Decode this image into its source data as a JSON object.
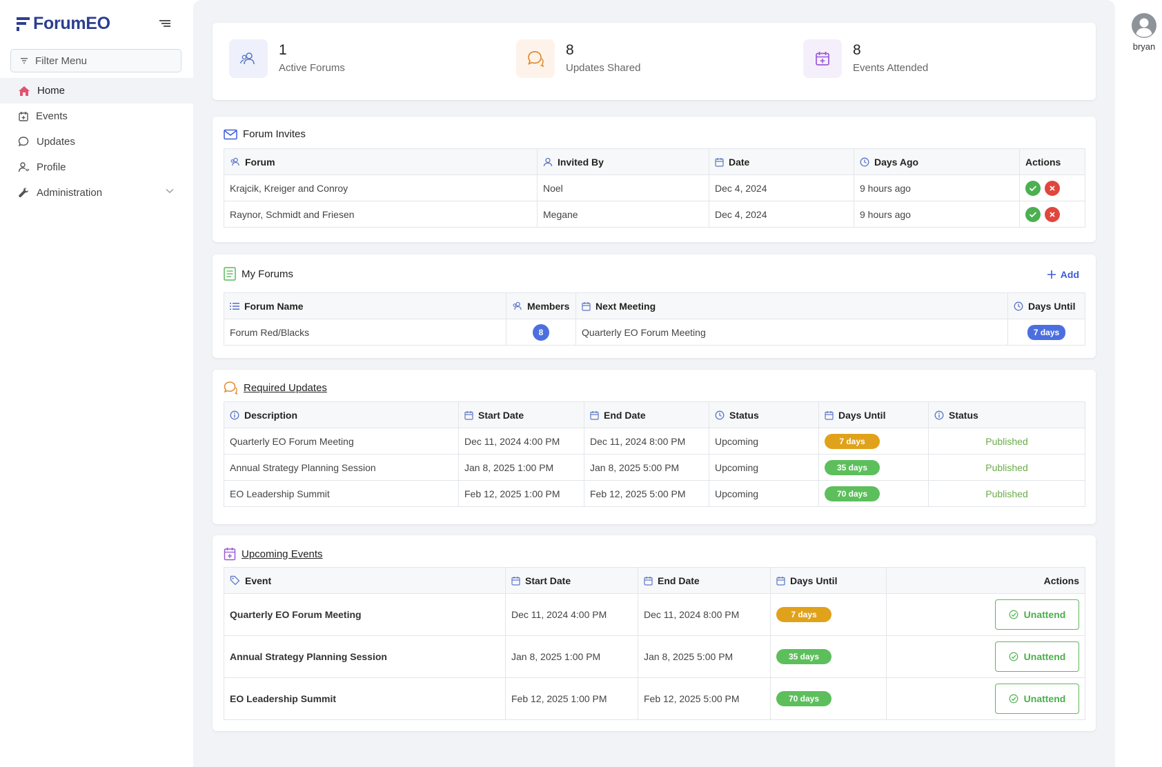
{
  "app": {
    "name": "ForumEO"
  },
  "sidebar": {
    "filter_placeholder": "Filter Menu",
    "items": [
      {
        "label": "Home",
        "icon": "home-icon"
      },
      {
        "label": "Events",
        "icon": "calendar-icon"
      },
      {
        "label": "Updates",
        "icon": "chat-icon"
      },
      {
        "label": "Profile",
        "icon": "user-icon"
      },
      {
        "label": "Administration",
        "icon": "wrench-icon"
      }
    ]
  },
  "user": {
    "name": "bryan"
  },
  "stats": [
    {
      "value": "1",
      "label": "Active Forums"
    },
    {
      "value": "8",
      "label": "Updates Shared"
    },
    {
      "value": "8",
      "label": "Events Attended"
    }
  ],
  "invites": {
    "title": "Forum Invites",
    "headers": [
      "Forum",
      "Invited By",
      "Date",
      "Days Ago",
      "Actions"
    ],
    "rows": [
      {
        "forum": "Krajcik, Kreiger and Conroy",
        "invited_by": "Noel",
        "date": "Dec 4, 2024",
        "days_ago": "9 hours ago"
      },
      {
        "forum": "Raynor, Schmidt and Friesen",
        "invited_by": "Megane",
        "date": "Dec 4, 2024",
        "days_ago": "9 hours ago"
      }
    ]
  },
  "forums": {
    "title": "My Forums",
    "add_label": "Add",
    "headers": [
      "Forum Name",
      "Members",
      "Next Meeting",
      "Days Until"
    ],
    "rows": [
      {
        "name": "Forum Red/Blacks",
        "members": "8",
        "next_meeting": "Quarterly EO Forum Meeting",
        "days_until": "7 days"
      }
    ]
  },
  "updates": {
    "title": "Required Updates",
    "headers": [
      "Description",
      "Start Date",
      "End Date",
      "Status",
      "Days Until",
      "Status"
    ],
    "rows": [
      {
        "description": "Quarterly EO Forum Meeting",
        "start": "Dec 11, 2024 4:00 PM",
        "end": "Dec 11, 2024 8:00 PM",
        "status": "Upcoming",
        "days_until": "7 days",
        "publish": "Published"
      },
      {
        "description": "Annual Strategy Planning Session",
        "start": "Jan 8, 2025 1:00 PM",
        "end": "Jan 8, 2025 5:00 PM",
        "status": "Upcoming",
        "days_until": "35 days",
        "publish": "Published"
      },
      {
        "description": "EO Leadership Summit",
        "start": "Feb 12, 2025 1:00 PM",
        "end": "Feb 12, 2025 5:00 PM",
        "status": "Upcoming",
        "days_until": "70 days",
        "publish": "Published"
      }
    ]
  },
  "events": {
    "title": "Upcoming Events",
    "headers": [
      "Event",
      "Start Date",
      "End Date",
      "Days Until",
      "Actions"
    ],
    "action_label": "Unattend",
    "rows": [
      {
        "event": "Quarterly EO Forum Meeting",
        "start": "Dec 11, 2024 4:00 PM",
        "end": "Dec 11, 2024 8:00 PM",
        "days_until": "7 days"
      },
      {
        "event": "Annual Strategy Planning Session",
        "start": "Jan 8, 2025 1:00 PM",
        "end": "Jan 8, 2025 5:00 PM",
        "days_until": "35 days"
      },
      {
        "event": "EO Leadership Summit",
        "start": "Feb 12, 2025 1:00 PM",
        "end": "Feb 12, 2025 5:00 PM",
        "days_until": "70 days"
      }
    ]
  },
  "colors": {
    "brand": "#2c3e8f",
    "accent": "#4c6fe0",
    "orange": "#e0a21a",
    "green": "#5cbf5c",
    "red": "#e0463d"
  }
}
